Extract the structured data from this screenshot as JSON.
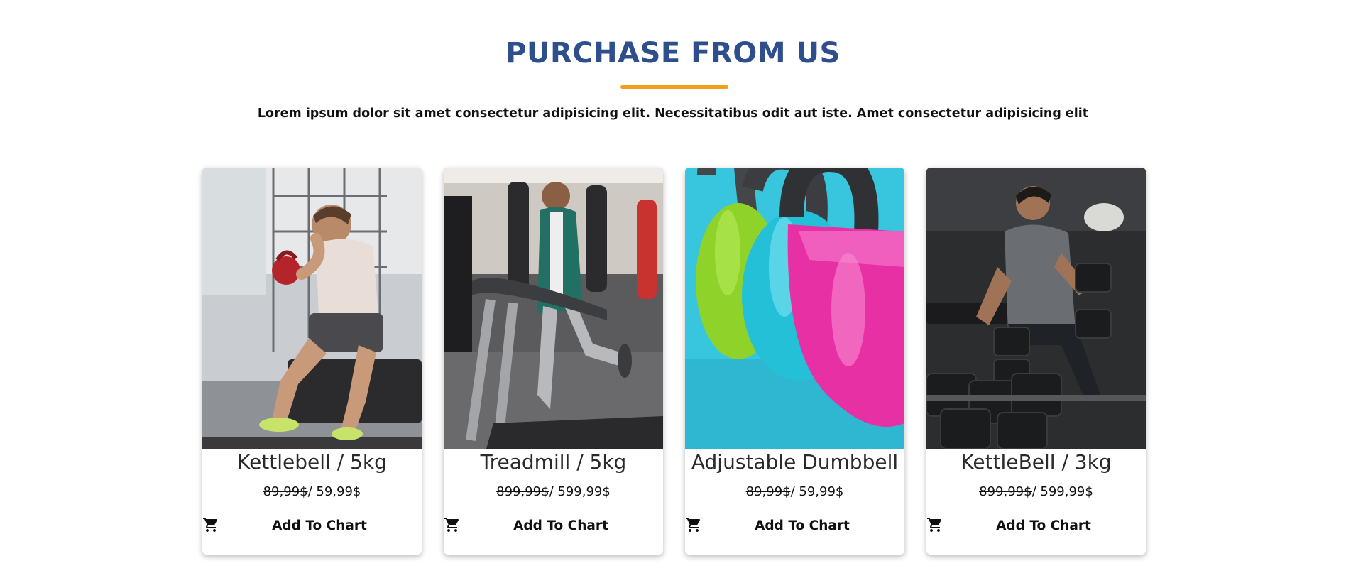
{
  "section": {
    "title": "PURCHASE FROM US",
    "subtitle": "Lorem ipsum dolor sit amet consectetur adipisicing elit. Necessitatibus odit aut iste. Amet consectetur adipisicing elit",
    "accent_color": "#f0a01d",
    "title_color": "#2f4e8c"
  },
  "products": [
    {
      "name": "Kettlebell / 5kg",
      "old_price": "89,99$",
      "price": "/ 59,99$",
      "button": "Add To Chart",
      "image": "man-with-kettlebell-photo",
      "icon": "cart-icon"
    },
    {
      "name": "Treadmill / 5kg",
      "old_price": "899,99$",
      "price": "/ 599,99$",
      "button": "Add To Chart",
      "image": "man-on-treadmill-photo",
      "icon": "cart-icon"
    },
    {
      "name": "Adjustable Dumbbell",
      "old_price": "89,99$",
      "price": "/ 59,99$",
      "button": "Add To Chart",
      "image": "colorful-kettlebells-photo",
      "icon": "cart-icon"
    },
    {
      "name": "KettleBell / 3kg",
      "old_price": "899,99$",
      "price": "/ 599,99$",
      "button": "Add To Chart",
      "image": "man-with-dumbbells-photo",
      "icon": "cart-icon"
    }
  ]
}
